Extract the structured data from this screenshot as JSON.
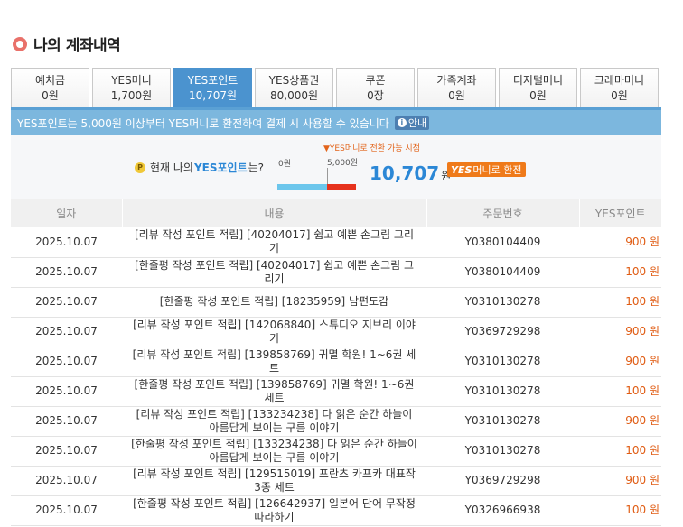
{
  "page_title": "나의 계좌내역",
  "tabs": [
    {
      "label": "예치금",
      "count": "0원",
      "active": false
    },
    {
      "label": "YES머니",
      "count": "1,700원",
      "active": false
    },
    {
      "label": "YES포인트",
      "count": "10,707원",
      "active": true
    },
    {
      "label": "YES상품권",
      "count": "80,000원",
      "active": false
    },
    {
      "label": "쿠폰",
      "count": "0장",
      "active": false
    },
    {
      "label": "가족계좌",
      "count": "0원",
      "active": false
    },
    {
      "label": "디지털머니",
      "count": "0원",
      "active": false
    },
    {
      "label": "크레마머니",
      "count": "0원",
      "active": false
    }
  ],
  "info_bar": {
    "text": "YES포인트는 5,000원 이상부터 YES머니로 환전하여 결제 시 사용할 수 있습니다",
    "guide_label": "안내"
  },
  "summary": {
    "label_prefix": "현재 나의",
    "label_highlight": "YES포인트",
    "label_suffix": "는?",
    "bar_zero": "0원",
    "bar_marker": "YES머니로 전환 가능 시점",
    "bar_threshold": "5,000원",
    "amount": "10,707",
    "amount_unit": "원",
    "convert_brand": "YES",
    "convert_label": "머니로 환전",
    "progress_fraction": 0.63
  },
  "table": {
    "headers": [
      "일자",
      "내용",
      "주문번호",
      "YES포인트"
    ],
    "rows": [
      {
        "date": "2025.10.07",
        "desc": "[리뷰 작성 포인트 적립] [40204017] 쉽고 예쁜 손그림 그리기",
        "order": "Y0380104409",
        "points": "900 원"
      },
      {
        "date": "2025.10.07",
        "desc": "[한줄평 작성 포인트 적립] [40204017] 쉽고 예쁜 손그림 그리기",
        "order": "Y0380104409",
        "points": "100 원"
      },
      {
        "date": "2025.10.07",
        "desc": "[한줄평 작성 포인트 적립] [18235959] 남편도감",
        "order": "Y0310130278",
        "points": "100 원"
      },
      {
        "date": "2025.10.07",
        "desc": "[리뷰 작성 포인트 적립] [142068840] 스튜디오 지브리 이야기",
        "order": "Y0369729298",
        "points": "900 원"
      },
      {
        "date": "2025.10.07",
        "desc": "[리뷰 작성 포인트 적립] [139858769] 귀멸 학원! 1~6권 세트",
        "order": "Y0310130278",
        "points": "900 원"
      },
      {
        "date": "2025.10.07",
        "desc": "[한줄평 작성 포인트 적립] [139858769] 귀멸 학원! 1~6권 세트",
        "order": "Y0310130278",
        "points": "100 원"
      },
      {
        "date": "2025.10.07",
        "desc": "[리뷰 작성 포인트 적립] [133234238] 다 읽은 순간 하늘이 아름답게 보이는 구름 이야기",
        "order": "Y0310130278",
        "points": "900 원"
      },
      {
        "date": "2025.10.07",
        "desc": "[한줄평 작성 포인트 적립] [133234238] 다 읽은 순간 하늘이 아름답게 보이는 구름 이야기",
        "order": "Y0310130278",
        "points": "100 원"
      },
      {
        "date": "2025.10.07",
        "desc": "[리뷰 작성 포인트 적립] [129515019] 프란츠 카프카 대표작 3종 세트",
        "order": "Y0369729298",
        "points": "900 원"
      },
      {
        "date": "2025.10.07",
        "desc": "[한줄평 작성 포인트 적립] [126642937] 일본어 단어 무작정 따라하기",
        "order": "Y0326966938",
        "points": "100 원"
      }
    ]
  }
}
